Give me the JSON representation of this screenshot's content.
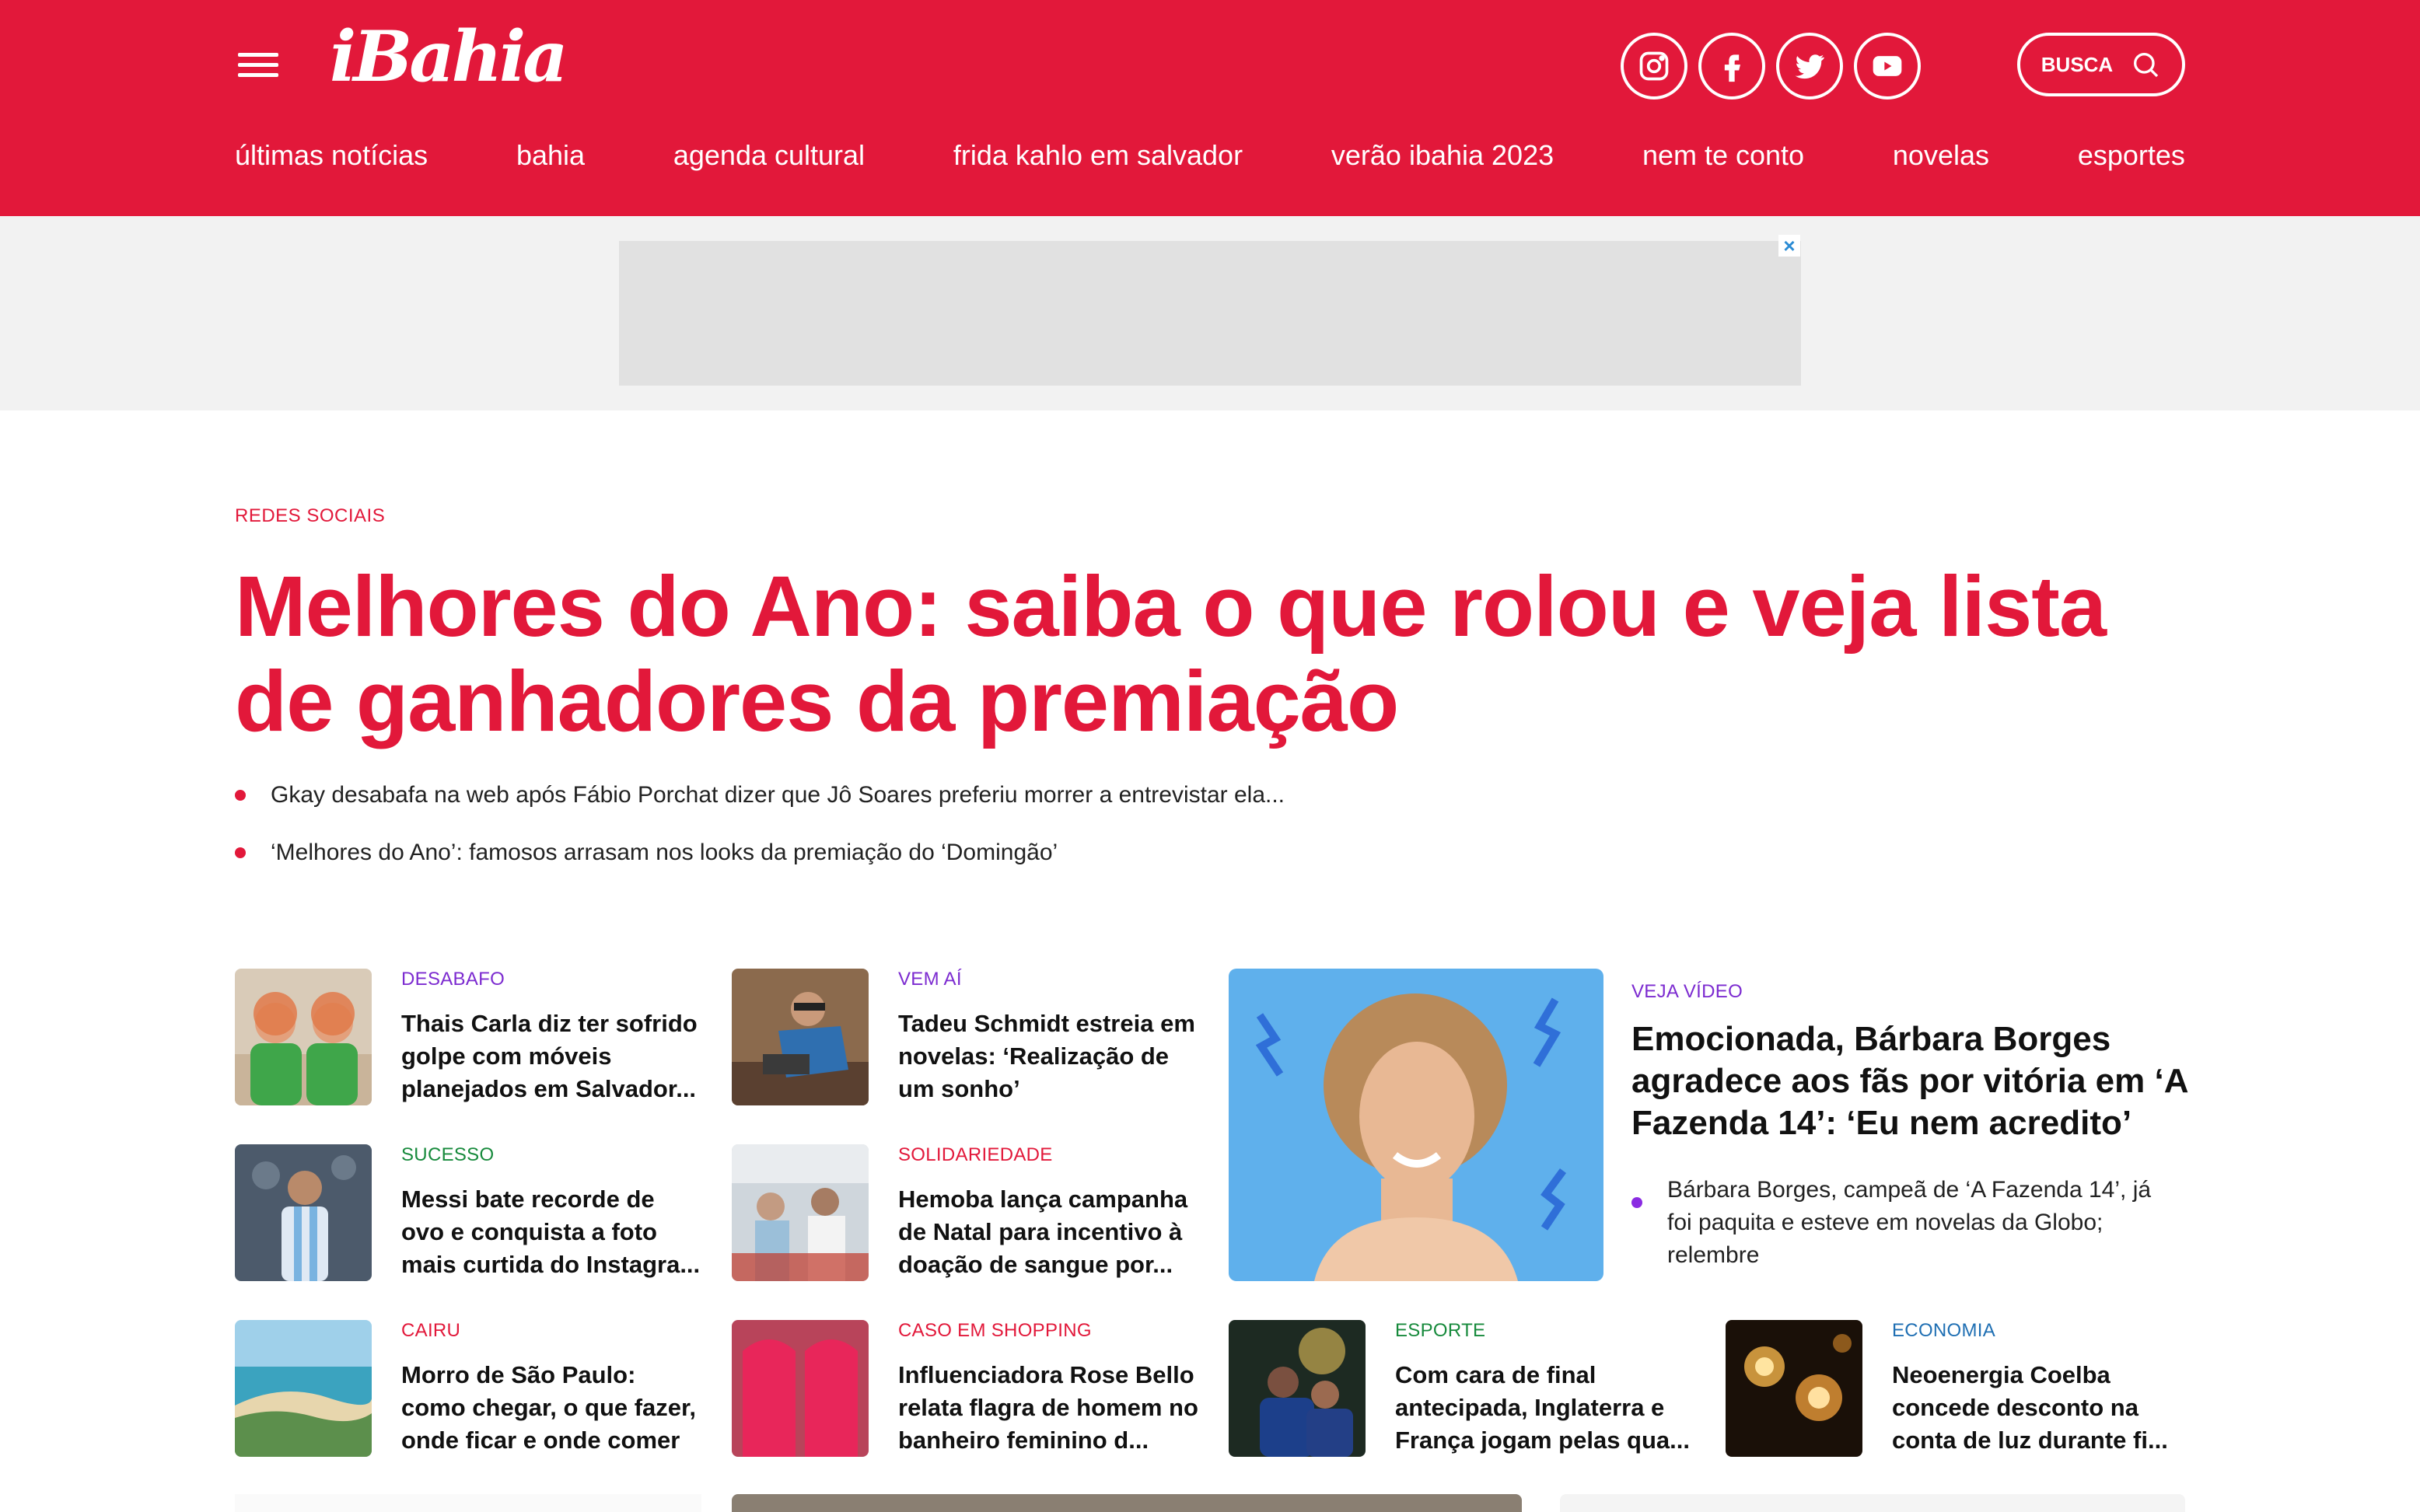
{
  "header": {
    "logo": "iBahia",
    "busca_label": "BUSCA",
    "social": [
      "instagram-icon",
      "facebook-icon",
      "twitter-icon",
      "youtube-icon"
    ],
    "brand_color": "#e2183a"
  },
  "nav": [
    "últimas notícias",
    "bahia",
    "agenda cultural",
    "frida kahlo em salvador",
    "verão ibahia 2023",
    "nem te conto",
    "novelas",
    "esportes"
  ],
  "ad": {
    "close_label": "×"
  },
  "main": {
    "kicker": "REDES SOCIAIS",
    "headline": "Melhores do Ano: saiba o que rolou e veja lista de ganhadores da premiação",
    "related": [
      "Gkay desabafa na web após Fábio Porchat dizer que Jô Soares preferiu morrer a entrevistar ela...",
      "‘Melhores do Ano’: famosos arrasam nos looks da premiação do ‘Domingão’"
    ]
  },
  "cards": [
    {
      "kicker": "DESABAFO",
      "kicker_color": "#7c2bd0",
      "title": "Thais Carla diz ter sofrido golpe com móveis planejados em Salvador..."
    },
    {
      "kicker": "VEM AÍ",
      "kicker_color": "#7c2bd0",
      "title": "Tadeu Schmidt estreia em novelas: ‘Realização de um sonho’"
    },
    {
      "kicker": "SUCESSO",
      "kicker_color": "#178a3c",
      "title": "Messi bate recorde de ovo e conquista a foto mais curtida do Instagra..."
    },
    {
      "kicker": "SOLIDARIEDADE",
      "kicker_color": "#e2183a",
      "title": "Hemoba lança campanha de Natal para incentivo à doação de sangue por..."
    },
    {
      "kicker": "CAIRU",
      "kicker_color": "#e2183a",
      "title": "Morro de São Paulo: como chegar, o que fazer, onde ficar e onde comer"
    },
    {
      "kicker": "CASO EM SHOPPING",
      "kicker_color": "#e2183a",
      "title": "Influenciadora Rose Bello relata flagra de homem no banheiro feminino d..."
    },
    {
      "kicker": "ESPORTE",
      "kicker_color": "#178a3c",
      "title": "Com cara de final antecipada, Inglaterra e França jogam pelas qua..."
    },
    {
      "kicker": "ECONOMIA",
      "kicker_color": "#1f6fb3",
      "title": "Neoenergia Coelba concede desconto na conta de luz durante fi..."
    }
  ],
  "feature": {
    "kicker": "VEJA VÍDEO",
    "title": "Emocionada, Bárbara Borges agradece aos fãs por vitória em ‘A Fazenda 14’: ‘Eu nem acredito’",
    "related": "Bárbara Borges, campeã de ‘A Fazenda 14’, já foi paquita e esteve em novelas da Globo; relembre"
  }
}
